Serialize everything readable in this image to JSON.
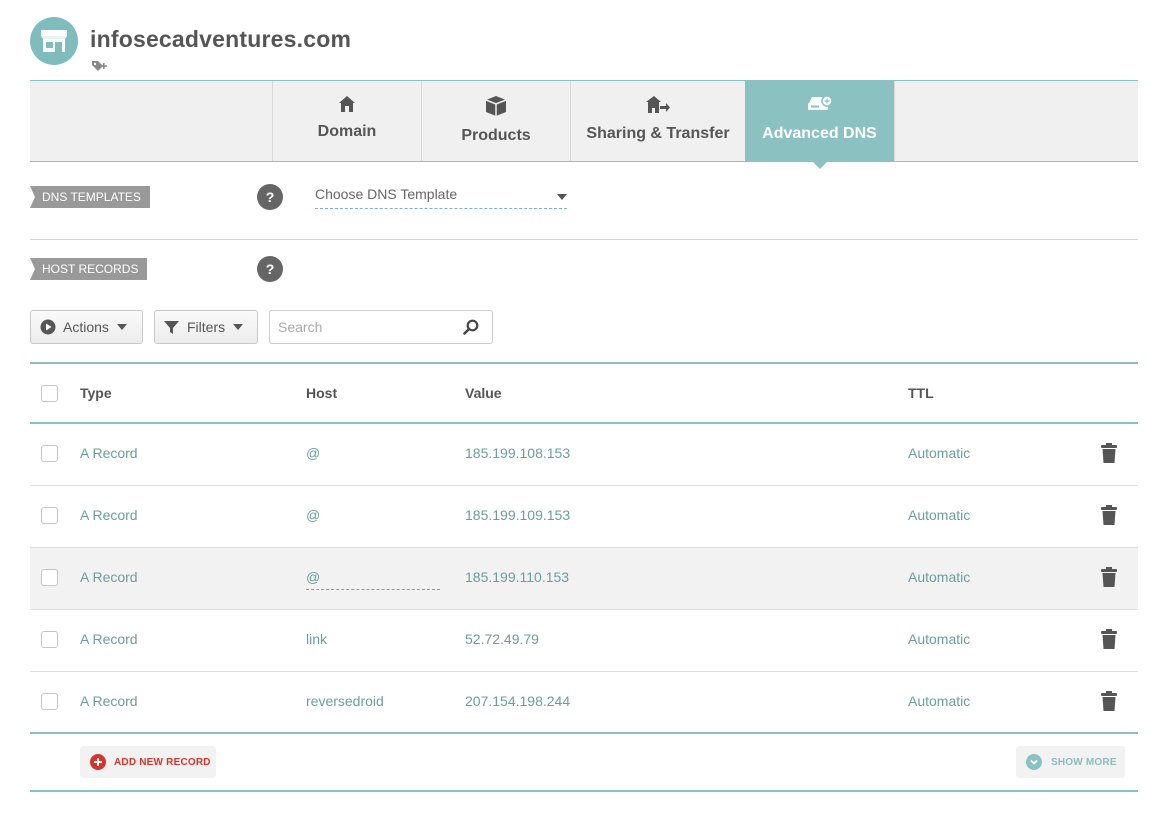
{
  "header": {
    "domain_title": "infosecadventures.com",
    "avatar_icon": "store-icon",
    "tag_icon": "tag-add-icon"
  },
  "tabs": [
    {
      "label": "Domain",
      "icon": "house-icon",
      "active": false
    },
    {
      "label": "Products",
      "icon": "box-icon",
      "active": false
    },
    {
      "label": "Sharing & Transfer",
      "icon": "house-transfer-icon",
      "active": false
    },
    {
      "label": "Advanced DNS",
      "icon": "dns-server-icon",
      "active": true
    }
  ],
  "dns_templates": {
    "label": "DNS TEMPLATES",
    "help": "?",
    "select_value": "Choose DNS Template"
  },
  "host_records": {
    "label": "HOST RECORDS",
    "help": "?"
  },
  "toolbar": {
    "actions_label": "Actions",
    "filters_label": "Filters",
    "search_placeholder": "Search"
  },
  "table": {
    "columns": [
      "Type",
      "Host",
      "Value",
      "TTL"
    ],
    "rows": [
      {
        "type": "A Record",
        "host": "@",
        "value": "185.199.108.153",
        "ttl": "Automatic"
      },
      {
        "type": "A Record",
        "host": "@",
        "value": "185.199.109.153",
        "ttl": "Automatic"
      },
      {
        "type": "A Record",
        "host": "@",
        "value": "185.199.110.153",
        "ttl": "Automatic"
      },
      {
        "type": "A Record",
        "host": "link",
        "value": "52.72.49.79",
        "ttl": "Automatic"
      },
      {
        "type": "A Record",
        "host": "reversedroid",
        "value": "207.154.198.244",
        "ttl": "Automatic"
      }
    ]
  },
  "footer": {
    "add_label": "ADD NEW RECORD",
    "more_label": "SHOW MORE"
  },
  "colors": {
    "accent": "#8cc1c1",
    "danger": "#d6342b",
    "text": "#555555",
    "value_text": "#6a9e9e"
  }
}
